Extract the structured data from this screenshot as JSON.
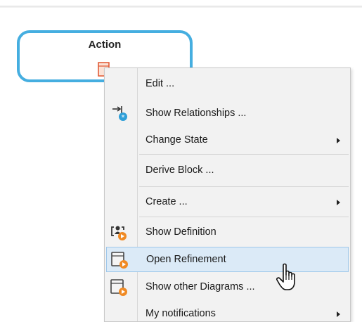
{
  "canvas": {
    "action_node": {
      "title": "Action"
    }
  },
  "context_menu": {
    "items": [
      {
        "label": "Edit ...",
        "icon": "",
        "submenu": false
      },
      {
        "label": "Show Relationships ...",
        "icon": "relationships-icon",
        "submenu": false
      },
      {
        "label": "Change State",
        "icon": "",
        "submenu": true
      },
      {
        "label": "Derive Block ...",
        "icon": "",
        "submenu": false
      },
      {
        "label": "Create ...",
        "icon": "",
        "submenu": true
      },
      {
        "label": "Show Definition",
        "icon": "definition-icon",
        "submenu": false
      },
      {
        "label": "Open Refinement",
        "icon": "open-refinement-icon",
        "submenu": false,
        "highlighted": true
      },
      {
        "label": "Show other Diagrams ...",
        "icon": "diagrams-icon",
        "submenu": false
      },
      {
        "label": "My notifications",
        "icon": "",
        "submenu": true
      }
    ]
  },
  "colors": {
    "node_border": "#45aee0",
    "highlight_bg": "#dbeaf7",
    "highlight_border": "#9ec7ea",
    "icon_orange": "#f08a24",
    "icon_blue": "#2f9fd8"
  },
  "cursor": {
    "icon": "hand-pointer-icon"
  }
}
